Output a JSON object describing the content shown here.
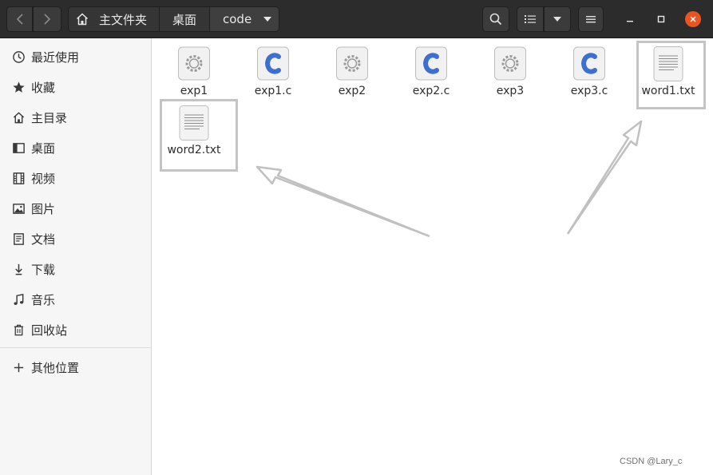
{
  "header": {
    "breadcrumbs": [
      "主文件夹",
      "桌面",
      "code"
    ]
  },
  "sidebar": {
    "items": [
      {
        "label": "最近使用",
        "icon": "clock-icon"
      },
      {
        "label": "收藏",
        "icon": "star-icon"
      },
      {
        "label": "主目录",
        "icon": "home-icon"
      },
      {
        "label": "桌面",
        "icon": "desktop-icon"
      },
      {
        "label": "视频",
        "icon": "film-icon"
      },
      {
        "label": "图片",
        "icon": "picture-icon"
      },
      {
        "label": "文档",
        "icon": "document-icon"
      },
      {
        "label": "下载",
        "icon": "download-icon"
      },
      {
        "label": "音乐",
        "icon": "music-icon"
      },
      {
        "label": "回收站",
        "icon": "trash-icon"
      }
    ],
    "other_locations": "其他位置"
  },
  "files": [
    {
      "name": "exp1",
      "icon": "executable-icon"
    },
    {
      "name": "exp1.c",
      "icon": "c-source-icon"
    },
    {
      "name": "exp2",
      "icon": "executable-icon"
    },
    {
      "name": "exp2.c",
      "icon": "c-source-icon"
    },
    {
      "name": "exp3",
      "icon": "executable-icon"
    },
    {
      "name": "exp3.c",
      "icon": "c-source-icon"
    },
    {
      "name": "word1.txt",
      "icon": "text-file-icon"
    },
    {
      "name": "word2.txt",
      "icon": "text-file-icon"
    }
  ],
  "watermark": "CSDN @Lary_c",
  "colors": {
    "header_bg": "#2c2c2c",
    "close_button": "#e95420",
    "c_icon": "#3d6fd1",
    "highlight_box": "#c4c4c4"
  }
}
